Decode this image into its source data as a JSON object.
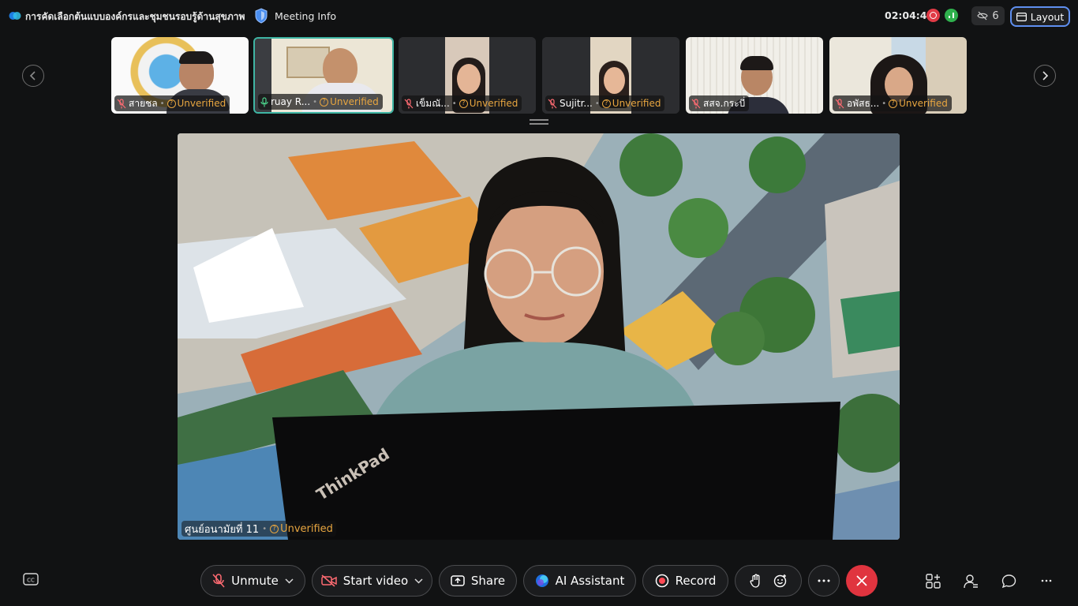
{
  "header": {
    "meeting_title": "การคัดเลือกต้นแบบองค์กรและชุมชนรอบรู้ด้านสุขภาพ",
    "info_label": "Meeting Info",
    "timer": "02:04:48",
    "hidden_participants": "6",
    "layout_label": "Layout"
  },
  "filmstrip": {
    "tiles": [
      {
        "name": "สายชล",
        "status": "Unverified",
        "muted": true
      },
      {
        "name": "ruay R...",
        "status": "Unverified",
        "muted": false
      },
      {
        "name": "เข็มณั...",
        "status": "Unverified",
        "muted": true
      },
      {
        "name": "Sujitr...",
        "status": "Unverified",
        "muted": true
      },
      {
        "name": "สสจ.กระบี่",
        "status": "Unverified",
        "muted": true
      },
      {
        "name": "อพัสธ...",
        "status": "Unverified",
        "muted": true
      }
    ]
  },
  "main_video": {
    "name": "ศูนย์อนามัยที่ 11",
    "status": "Unverified",
    "laptop_brand": "ThinkPad"
  },
  "toolbar": {
    "unmute_label": "Unmute",
    "video_label": "Start video",
    "share_label": "Share",
    "ai_label": "AI Assistant",
    "record_label": "Record"
  },
  "colors": {
    "background": "#111213",
    "unverified": "#e8a640",
    "leave": "#e0343f",
    "active_border": "#3fb5a4",
    "layout_border": "#5f8ff0"
  }
}
